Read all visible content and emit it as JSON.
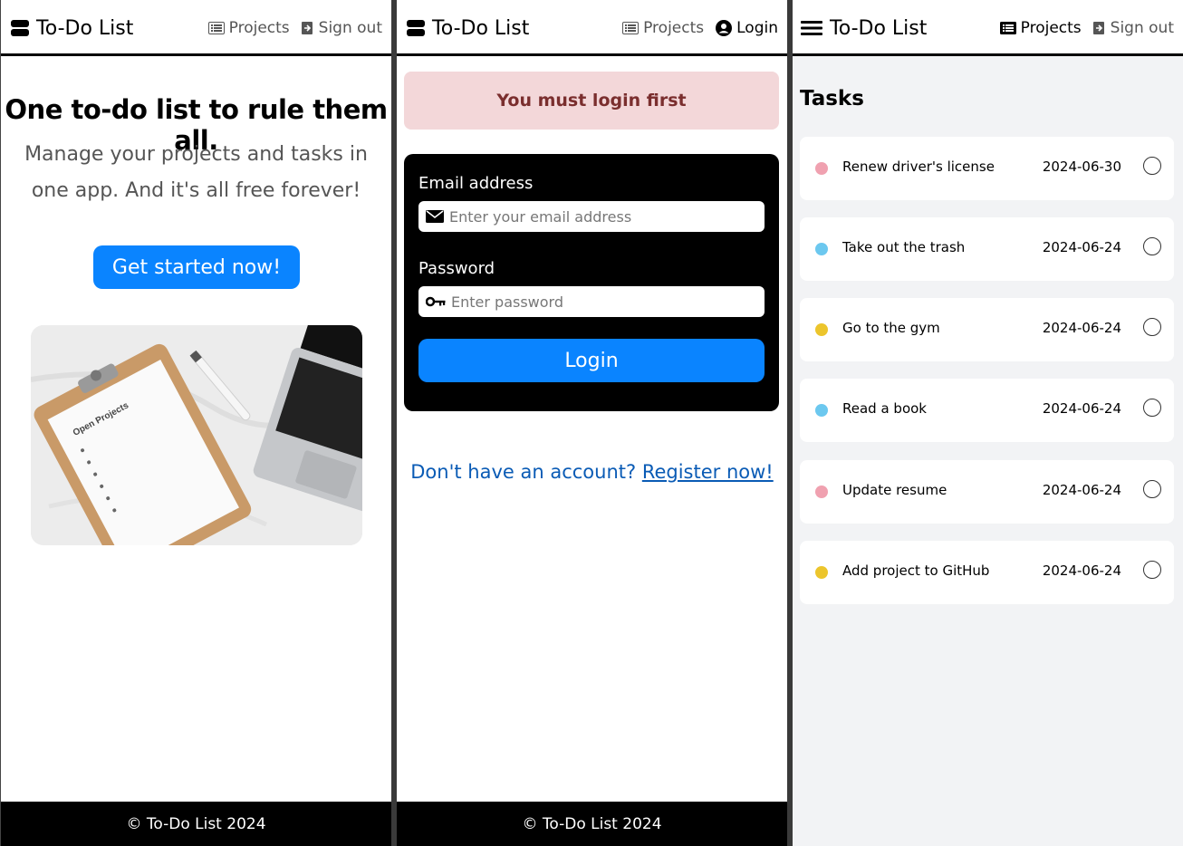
{
  "brand": {
    "title": "To-Do List"
  },
  "nav": {
    "projects": "Projects",
    "sign_out": "Sign out",
    "login": "Login"
  },
  "home": {
    "headline": "One to-do list to rule them all.",
    "subtitle": "Manage your projects and tasks in one app. And it's all free forever!",
    "cta": "Get started now!",
    "image_text": "Open Projects"
  },
  "login_page": {
    "alert": "You must login first",
    "email_label": "Email address",
    "email_placeholder": "Enter your email address",
    "password_label": "Password",
    "password_placeholder": "Enter password",
    "submit": "Login",
    "register_prompt": "Don't have an account?",
    "register_link": "Register now!"
  },
  "tasks_page": {
    "title": "Tasks",
    "items": [
      {
        "name": "Renew driver's license",
        "date": "2024-06-30",
        "color": "#f0a1b0"
      },
      {
        "name": "Take out the trash",
        "date": "2024-06-24",
        "color": "#6cc8ef"
      },
      {
        "name": "Go to the gym",
        "date": "2024-06-24",
        "color": "#ecc52c"
      },
      {
        "name": "Read a book",
        "date": "2024-06-24",
        "color": "#6cc8ef"
      },
      {
        "name": "Update resume",
        "date": "2024-06-24",
        "color": "#f0a1b0"
      },
      {
        "name": "Add project to GitHub",
        "date": "2024-06-24",
        "color": "#ecc52c"
      }
    ]
  },
  "footer": {
    "text": "© To-Do List 2024"
  },
  "colors": {
    "accent": "#0a84ff",
    "alert_bg": "#f3d7d9",
    "alert_text": "#7a2e2e",
    "link": "#0a5bb5"
  }
}
